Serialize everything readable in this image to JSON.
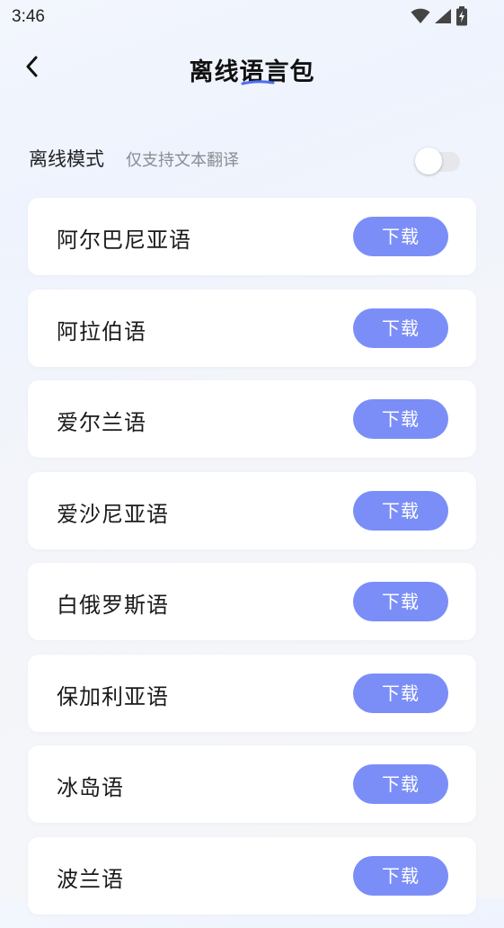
{
  "status_bar": {
    "time": "3:46",
    "icons": [
      "wifi-icon",
      "signal-icon",
      "battery-icon"
    ]
  },
  "header": {
    "title": "离线语言包",
    "back_icon": "chevron-left-icon"
  },
  "offline_mode": {
    "label": "离线模式",
    "description": "仅支持文本翻译",
    "enabled": false
  },
  "languages": [
    {
      "name": "阿尔巴尼亚语",
      "action": "下载"
    },
    {
      "name": "阿拉伯语",
      "action": "下载"
    },
    {
      "name": "爱尔兰语",
      "action": "下载"
    },
    {
      "name": "爱沙尼亚语",
      "action": "下载"
    },
    {
      "name": "白俄罗斯语",
      "action": "下载"
    },
    {
      "name": "保加利亚语",
      "action": "下载"
    },
    {
      "name": "冰岛语",
      "action": "下载"
    },
    {
      "name": "波兰语",
      "action": "下载"
    }
  ],
  "colors": {
    "accent": "#7b8ef7",
    "title_underline": "#4f6ef0",
    "toggle_off": "#e6e7ea"
  }
}
